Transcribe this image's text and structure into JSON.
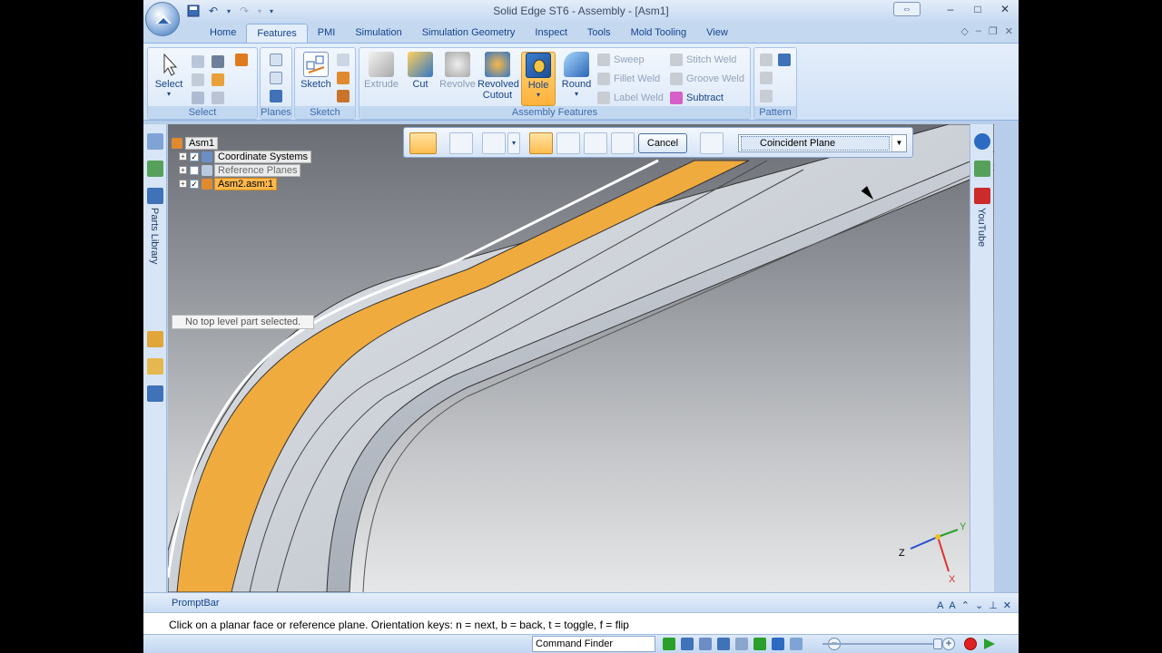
{
  "app": {
    "title": "Solid Edge ST6 - Assembly - [Asm1]"
  },
  "tabs": [
    {
      "label": "Home"
    },
    {
      "label": "Features",
      "active": true
    },
    {
      "label": "PMI"
    },
    {
      "label": "Simulation"
    },
    {
      "label": "Simulation Geometry"
    },
    {
      "label": "Inspect"
    },
    {
      "label": "Tools"
    },
    {
      "label": "Mold Tooling"
    },
    {
      "label": "View"
    }
  ],
  "ribbon": {
    "select": {
      "group_label": "Select",
      "select_label": "Select"
    },
    "planes": {
      "group_label": "Planes"
    },
    "sketch": {
      "group_label": "Sketch",
      "sketch_label": "Sketch"
    },
    "assembly_features": {
      "group_label": "Assembly Features",
      "extrude": "Extrude",
      "cut": "Cut",
      "revolve": "Revolve",
      "revolved_cutout": "Revolved Cutout",
      "hole": "Hole",
      "round": "Round",
      "sweep": "Sweep",
      "fillet_weld": "Fillet Weld",
      "label_weld": "Label Weld",
      "stitch_weld": "Stitch Weld",
      "groove_weld": "Groove Weld",
      "subtract": "Subtract"
    },
    "pattern": {
      "group_label": "Pattern"
    }
  },
  "tree": {
    "root": "Asm1",
    "items": [
      {
        "label": "Coordinate Systems",
        "checked": true
      },
      {
        "label": "Reference Planes",
        "checked": false
      },
      {
        "label": "Asm2.asm:1",
        "checked": true,
        "selected": true
      }
    ],
    "status": "No top level part selected."
  },
  "left_panel": {
    "parts_library": "Parts Library"
  },
  "right_panel": {
    "youtube": "YouTube"
  },
  "command_bar": {
    "cancel_label": "Cancel",
    "plane_option": "Coincident Plane"
  },
  "triad": {
    "x": "X",
    "y": "Y",
    "z": "Z"
  },
  "prompt_bar": {
    "title": "PromptBar",
    "message": "Click on a planar face or reference plane.  Orientation keys:  n = next, b = back, t = toggle, f = flip"
  },
  "status_bar": {
    "command_finder": "Command Finder"
  },
  "colors": {
    "accent_orange": "#f0ab3f",
    "ribbon_blue": "#c4d8f0",
    "model_gray": "#c8ccd2"
  }
}
